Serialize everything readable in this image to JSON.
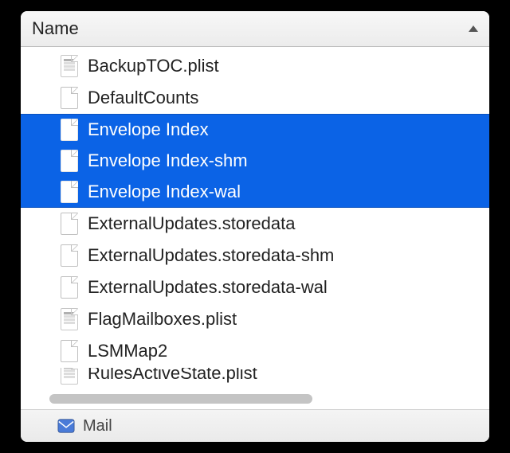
{
  "header": {
    "column_title": "Name",
    "sort_direction": "ascending"
  },
  "files": [
    {
      "name": "BackupTOC.plist",
      "icon": "plist",
      "selected": false
    },
    {
      "name": "DefaultCounts",
      "icon": "generic",
      "selected": false
    },
    {
      "name": "Envelope Index",
      "icon": "generic",
      "selected": true
    },
    {
      "name": "Envelope Index-shm",
      "icon": "generic",
      "selected": true
    },
    {
      "name": "Envelope Index-wal",
      "icon": "generic",
      "selected": true
    },
    {
      "name": "ExternalUpdates.storedata",
      "icon": "generic",
      "selected": false
    },
    {
      "name": "ExternalUpdates.storedata-shm",
      "icon": "generic",
      "selected": false
    },
    {
      "name": "ExternalUpdates.storedata-wal",
      "icon": "generic",
      "selected": false
    },
    {
      "name": "FlagMailboxes.plist",
      "icon": "plist",
      "selected": false
    },
    {
      "name": "LSMMap2",
      "icon": "generic",
      "selected": false
    },
    {
      "name": "RulesActiveState.plist",
      "icon": "plist",
      "selected": false,
      "partial": true
    }
  ],
  "status_bar": {
    "folder_name": "Mail",
    "icon": "mail-app-icon"
  },
  "colors": {
    "selection": "#0b63e6"
  }
}
